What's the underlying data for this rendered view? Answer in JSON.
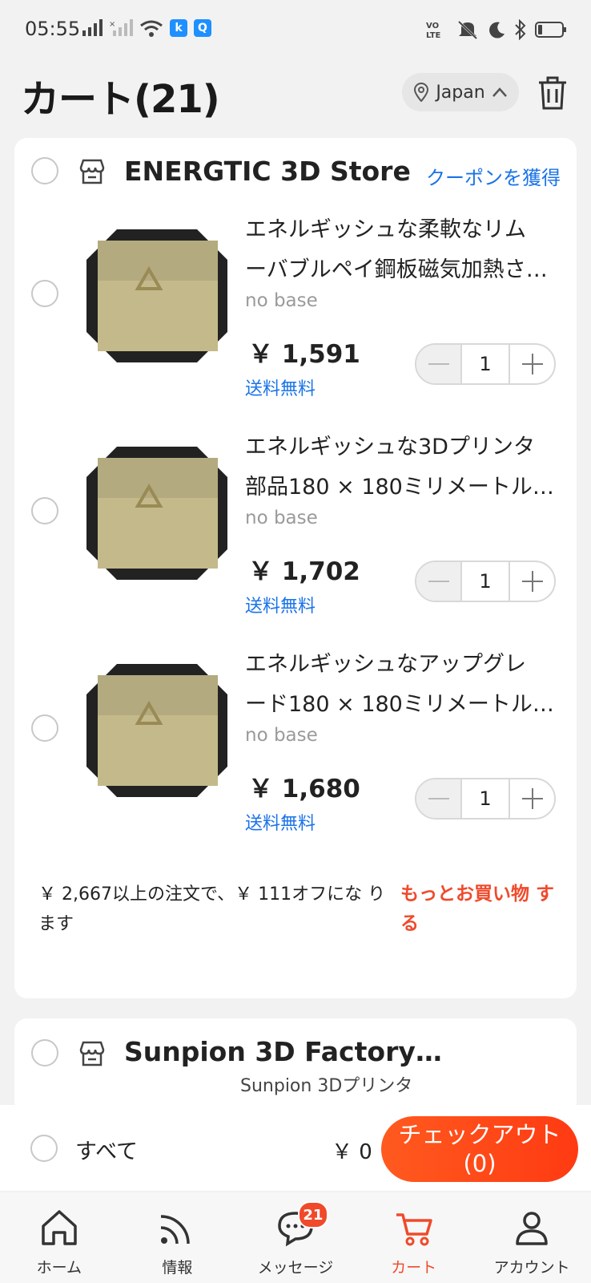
{
  "status_bar": {
    "time": "05:55",
    "app_badges": [
      "k",
      "Q"
    ]
  },
  "header": {
    "title": "カート(21)",
    "region": "Japan"
  },
  "stores": [
    {
      "name": "ENERGTIC 3D Store",
      "coupon_link": "クーポンを獲得",
      "items": [
        {
          "title_line1": "エネルギッシュな柔軟なリム",
          "title_line2": "ーバブルペイ鋼板磁気加熱さ…",
          "variant": "no base",
          "price": "￥ 1,591",
          "shipping": "送料無料",
          "quantity": "1"
        },
        {
          "title_line1": "エネルギッシュな3Dプリンタ",
          "title_line2": "部品180 × 180ミリメートル…",
          "variant": "no base",
          "price": "￥ 1,702",
          "shipping": "送料無料",
          "quantity": "1"
        },
        {
          "title_line1": "エネルギッシュなアップグレ",
          "title_line2": "ード180 × 180ミリメートルk…",
          "variant": "no base",
          "price": "￥ 1,680",
          "shipping": "送料無料",
          "quantity": "1"
        }
      ],
      "promo_text": "￥ 2,667以上の注文で、￥ 111オフにな ります",
      "promo_link": "もっとお買い物 する"
    },
    {
      "name": "Sunpion 3D Factory…",
      "partial_item_title": "Sunpion 3Dプリンタ"
    }
  ],
  "checkout": {
    "select_all": "すべて",
    "total": "￥ 0",
    "button_line1": "チェックアウト",
    "button_line2": "(0)"
  },
  "nav": [
    {
      "label": "ホーム",
      "icon": "home-icon"
    },
    {
      "label": "情報",
      "icon": "feed-icon"
    },
    {
      "label": "メッセージ",
      "icon": "message-icon",
      "badge": "21"
    },
    {
      "label": "カート",
      "icon": "cart-icon",
      "active": true
    },
    {
      "label": "アカウント",
      "icon": "account-icon"
    }
  ],
  "colors": {
    "accent": "#f04a2b",
    "link": "#1a73e8",
    "background": "#f2f2f2"
  }
}
